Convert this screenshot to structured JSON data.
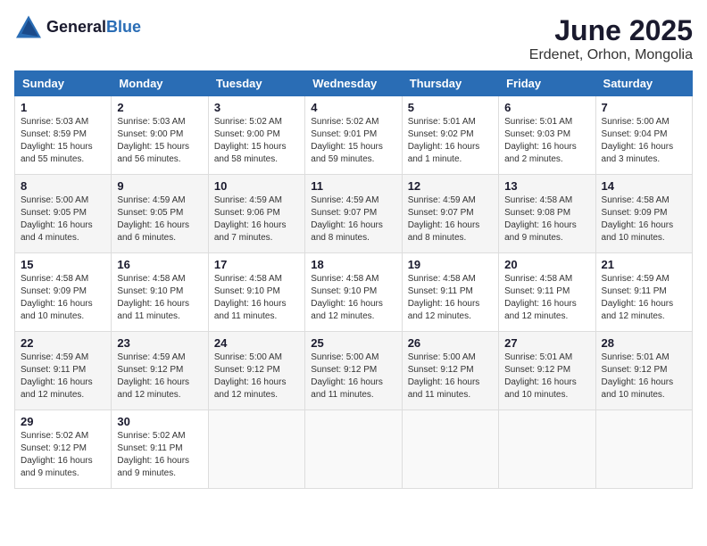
{
  "header": {
    "logo_general": "General",
    "logo_blue": "Blue",
    "title": "June 2025",
    "subtitle": "Erdenet, Orhon, Mongolia"
  },
  "days_of_week": [
    "Sunday",
    "Monday",
    "Tuesday",
    "Wednesday",
    "Thursday",
    "Friday",
    "Saturday"
  ],
  "weeks": [
    [
      {
        "day": "1",
        "sunrise": "5:03 AM",
        "sunset": "8:59 PM",
        "daylight": "15 hours and 55 minutes."
      },
      {
        "day": "2",
        "sunrise": "5:03 AM",
        "sunset": "9:00 PM",
        "daylight": "15 hours and 56 minutes."
      },
      {
        "day": "3",
        "sunrise": "5:02 AM",
        "sunset": "9:00 PM",
        "daylight": "15 hours and 58 minutes."
      },
      {
        "day": "4",
        "sunrise": "5:02 AM",
        "sunset": "9:01 PM",
        "daylight": "15 hours and 59 minutes."
      },
      {
        "day": "5",
        "sunrise": "5:01 AM",
        "sunset": "9:02 PM",
        "daylight": "16 hours and 1 minute."
      },
      {
        "day": "6",
        "sunrise": "5:01 AM",
        "sunset": "9:03 PM",
        "daylight": "16 hours and 2 minutes."
      },
      {
        "day": "7",
        "sunrise": "5:00 AM",
        "sunset": "9:04 PM",
        "daylight": "16 hours and 3 minutes."
      }
    ],
    [
      {
        "day": "8",
        "sunrise": "5:00 AM",
        "sunset": "9:05 PM",
        "daylight": "16 hours and 4 minutes."
      },
      {
        "day": "9",
        "sunrise": "4:59 AM",
        "sunset": "9:05 PM",
        "daylight": "16 hours and 6 minutes."
      },
      {
        "day": "10",
        "sunrise": "4:59 AM",
        "sunset": "9:06 PM",
        "daylight": "16 hours and 7 minutes."
      },
      {
        "day": "11",
        "sunrise": "4:59 AM",
        "sunset": "9:07 PM",
        "daylight": "16 hours and 8 minutes."
      },
      {
        "day": "12",
        "sunrise": "4:59 AM",
        "sunset": "9:07 PM",
        "daylight": "16 hours and 8 minutes."
      },
      {
        "day": "13",
        "sunrise": "4:58 AM",
        "sunset": "9:08 PM",
        "daylight": "16 hours and 9 minutes."
      },
      {
        "day": "14",
        "sunrise": "4:58 AM",
        "sunset": "9:09 PM",
        "daylight": "16 hours and 10 minutes."
      }
    ],
    [
      {
        "day": "15",
        "sunrise": "4:58 AM",
        "sunset": "9:09 PM",
        "daylight": "16 hours and 10 minutes."
      },
      {
        "day": "16",
        "sunrise": "4:58 AM",
        "sunset": "9:10 PM",
        "daylight": "16 hours and 11 minutes."
      },
      {
        "day": "17",
        "sunrise": "4:58 AM",
        "sunset": "9:10 PM",
        "daylight": "16 hours and 11 minutes."
      },
      {
        "day": "18",
        "sunrise": "4:58 AM",
        "sunset": "9:10 PM",
        "daylight": "16 hours and 12 minutes."
      },
      {
        "day": "19",
        "sunrise": "4:58 AM",
        "sunset": "9:11 PM",
        "daylight": "16 hours and 12 minutes."
      },
      {
        "day": "20",
        "sunrise": "4:58 AM",
        "sunset": "9:11 PM",
        "daylight": "16 hours and 12 minutes."
      },
      {
        "day": "21",
        "sunrise": "4:59 AM",
        "sunset": "9:11 PM",
        "daylight": "16 hours and 12 minutes."
      }
    ],
    [
      {
        "day": "22",
        "sunrise": "4:59 AM",
        "sunset": "9:11 PM",
        "daylight": "16 hours and 12 minutes."
      },
      {
        "day": "23",
        "sunrise": "4:59 AM",
        "sunset": "9:12 PM",
        "daylight": "16 hours and 12 minutes."
      },
      {
        "day": "24",
        "sunrise": "5:00 AM",
        "sunset": "9:12 PM",
        "daylight": "16 hours and 12 minutes."
      },
      {
        "day": "25",
        "sunrise": "5:00 AM",
        "sunset": "9:12 PM",
        "daylight": "16 hours and 11 minutes."
      },
      {
        "day": "26",
        "sunrise": "5:00 AM",
        "sunset": "9:12 PM",
        "daylight": "16 hours and 11 minutes."
      },
      {
        "day": "27",
        "sunrise": "5:01 AM",
        "sunset": "9:12 PM",
        "daylight": "16 hours and 10 minutes."
      },
      {
        "day": "28",
        "sunrise": "5:01 AM",
        "sunset": "9:12 PM",
        "daylight": "16 hours and 10 minutes."
      }
    ],
    [
      {
        "day": "29",
        "sunrise": "5:02 AM",
        "sunset": "9:12 PM",
        "daylight": "16 hours and 9 minutes."
      },
      {
        "day": "30",
        "sunrise": "5:02 AM",
        "sunset": "9:11 PM",
        "daylight": "16 hours and 9 minutes."
      },
      null,
      null,
      null,
      null,
      null
    ]
  ]
}
